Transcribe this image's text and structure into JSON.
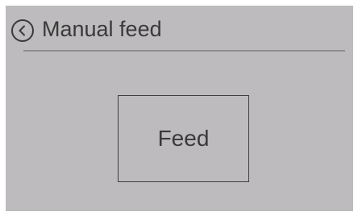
{
  "header": {
    "title": "Manual feed",
    "back_icon": "chevron-left-circle-icon"
  },
  "main": {
    "feed_label": "Feed"
  },
  "colors": {
    "screen_background": "#bdbbbd",
    "text": "#3a3a3a",
    "divider": "#8e8e90",
    "button_border": "#3f3f3f"
  }
}
